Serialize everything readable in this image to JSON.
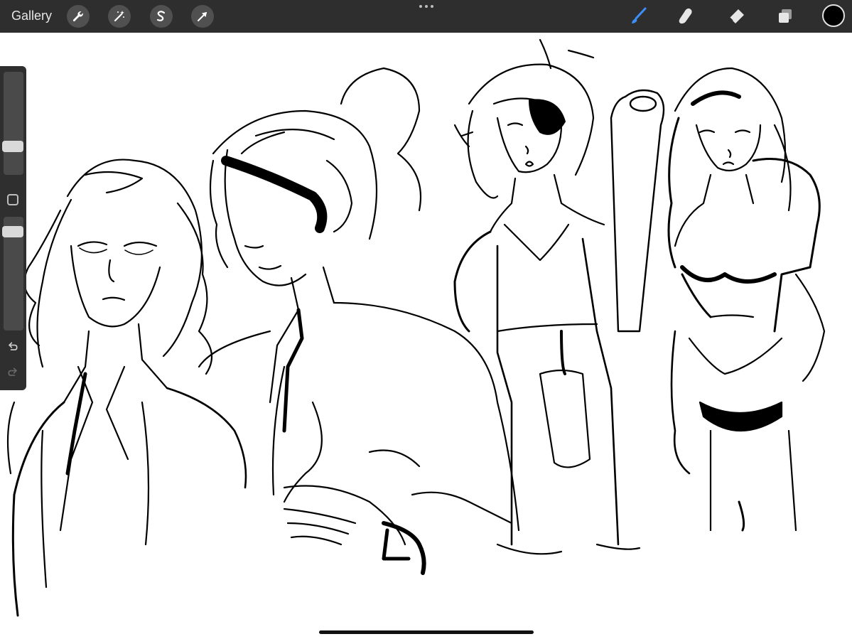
{
  "app": {
    "gallery_label": "Gallery"
  },
  "toolbar": {
    "left_tools": [
      {
        "name": "actions",
        "icon": "wrench-icon"
      },
      {
        "name": "adjustments",
        "icon": "magic-wand-icon"
      },
      {
        "name": "selection",
        "icon": "selection-s-icon"
      },
      {
        "name": "transform",
        "icon": "arrow-cursor-icon"
      }
    ],
    "right_tools": [
      {
        "name": "brush",
        "icon": "brush-icon",
        "active": true,
        "color": "#3d8ef7"
      },
      {
        "name": "smudge",
        "icon": "smudge-finger-icon",
        "active": false
      },
      {
        "name": "eraser",
        "icon": "eraser-icon",
        "active": false
      },
      {
        "name": "layers",
        "icon": "layers-icon",
        "active": false
      }
    ],
    "current_color": "#000000"
  },
  "sidebar": {
    "brush_size": 0.25,
    "brush_opacity": 0.9,
    "icons": [
      "square-modifier-icon",
      "undo-icon",
      "redo-icon"
    ]
  },
  "colors": {
    "toolbar_bg": "#2e2e2e",
    "sidebar_bg": "#2f2f2f",
    "canvas_bg": "#ffffff",
    "accent": "#3d8ef7"
  }
}
